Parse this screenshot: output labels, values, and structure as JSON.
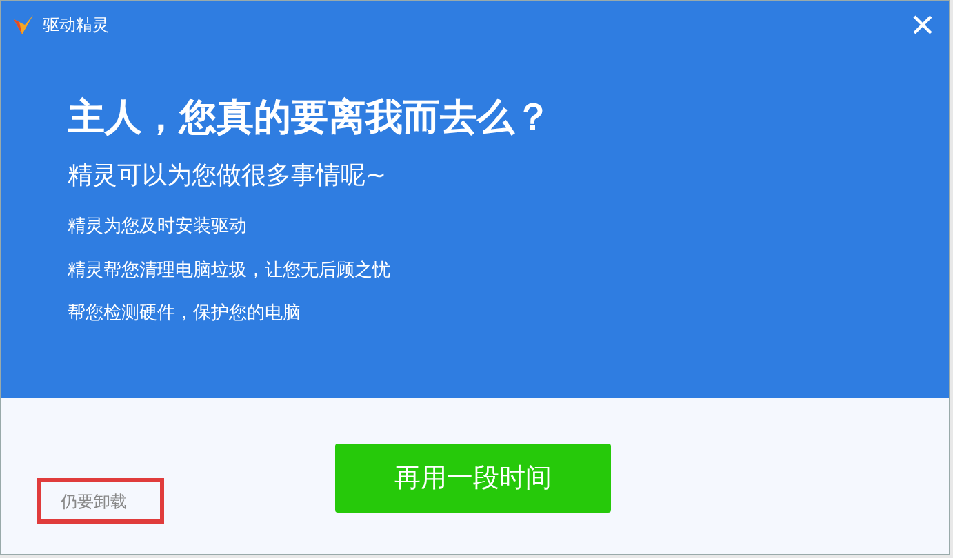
{
  "window": {
    "title": "驱动精灵"
  },
  "heading": "主人，您真的要离我而去么？",
  "subtitle": "精灵可以为您做很多事情呢~",
  "features": [
    "精灵为您及时安装驱动",
    "精灵帮您清理电脑垃圾，让您无后顾之忧",
    "帮您检测硬件，保护您的电脑"
  ],
  "primary_button": "再用一段时间",
  "uninstall_link": {
    "label": "仍要卸载",
    "highlighted": true
  }
}
